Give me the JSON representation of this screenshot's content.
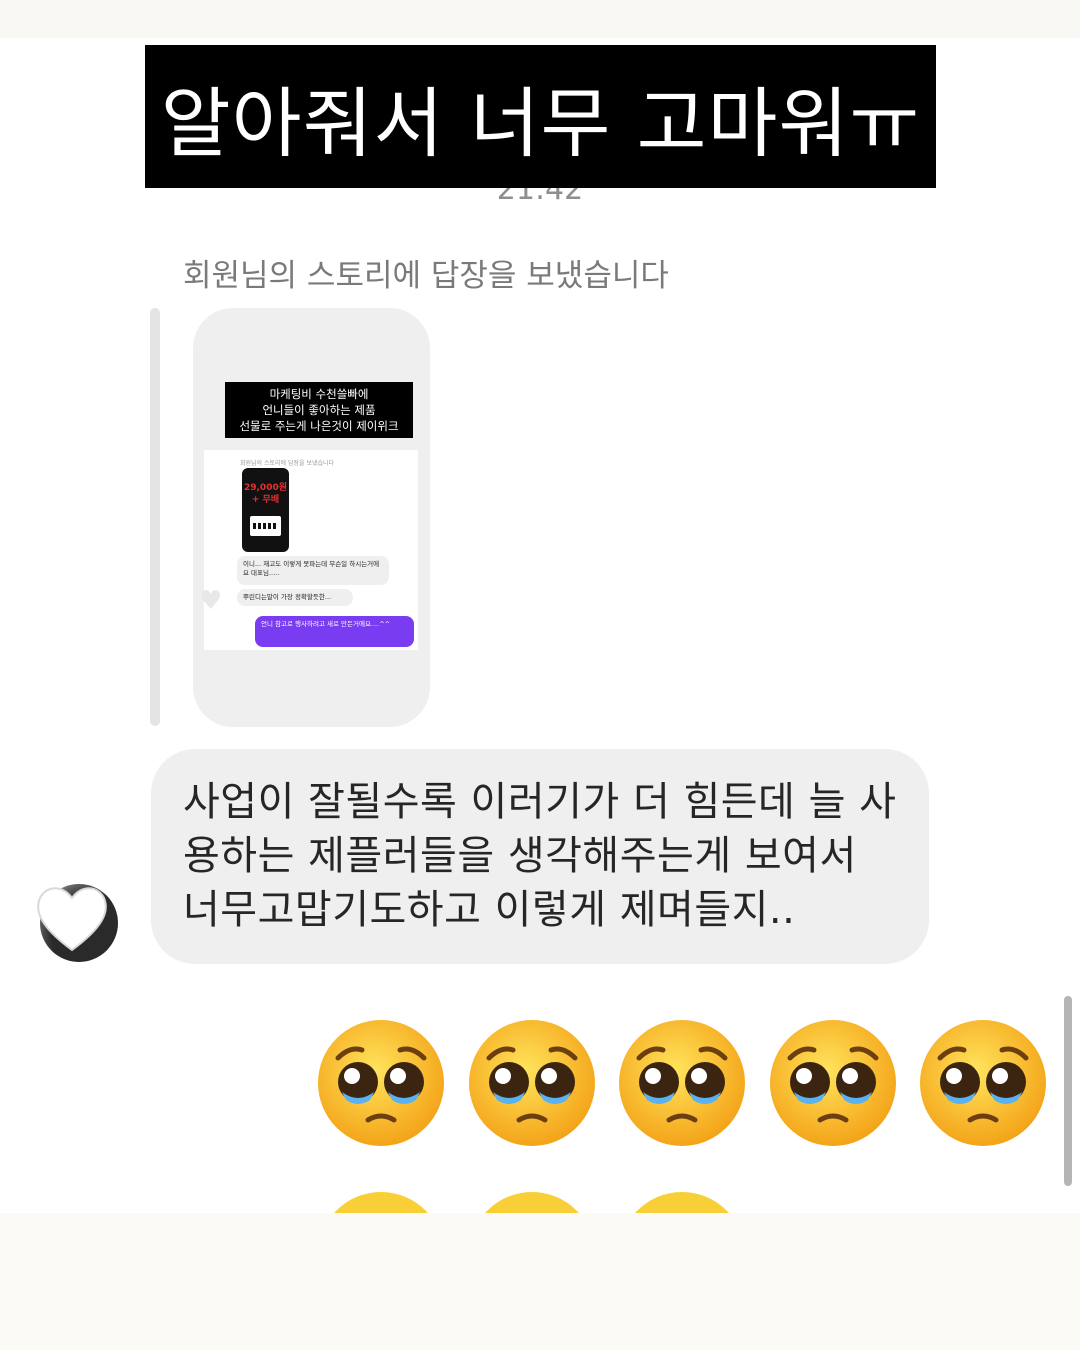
{
  "caption": "알아줘서 너무 고마워ㅠ",
  "thread": {
    "timestamp": "21:42",
    "reply_notice": "회원님의 스토리에 답장을 보냈습니다",
    "story": {
      "title_lines": [
        "마케팅비 수천쓸빠에",
        "언니들이 좋아하는 제품",
        "선물로 주는게 나은것이 제이위크"
      ],
      "inner_notice": "회원님의 스토리에 답장을 보냈습니다",
      "phone_price": "29,000원\n+ 무배",
      "bubble1": "이니... 재고도 이렇게 못파는데 무슨일 하시는거에요 대표님.....",
      "bubble2": "뿌린디는말이 가장 정확할듯한...",
      "bubble3": "언니 참고로 행사하려고 새로 만든거에요....^^"
    },
    "message": "사업이 잘될수록 이러기가 더 힘든데 늘 사용하는 제플러들을 생각해주는게 보여서 너무고맙기도하고 이렇게 제며들지..",
    "emoji_name": "pleading-face",
    "emoji_count_full": 5,
    "emoji_count_partial": 3
  }
}
